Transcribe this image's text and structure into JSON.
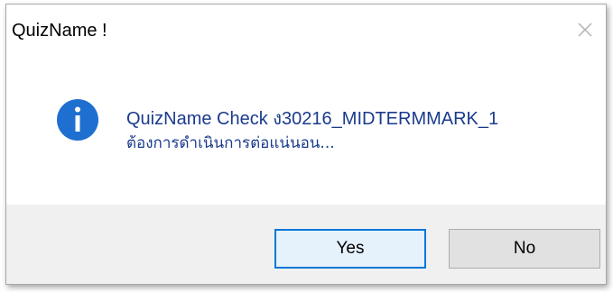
{
  "window": {
    "title": "QuizName !",
    "close_icon": "close-icon"
  },
  "message": {
    "icon": "info-icon",
    "line1": "QuizName Check ง30216_MIDTERMMARK_1",
    "line2": "ต้องการดำเนินการต่อแน่นอน..."
  },
  "buttons": {
    "yes_label": "Yes",
    "no_label": "No"
  },
  "colors": {
    "icon_blue": "#1e6fd0",
    "message_text": "#1a3b8c",
    "default_button_border": "#0078d7",
    "footer_bg": "#f0f0f0"
  }
}
